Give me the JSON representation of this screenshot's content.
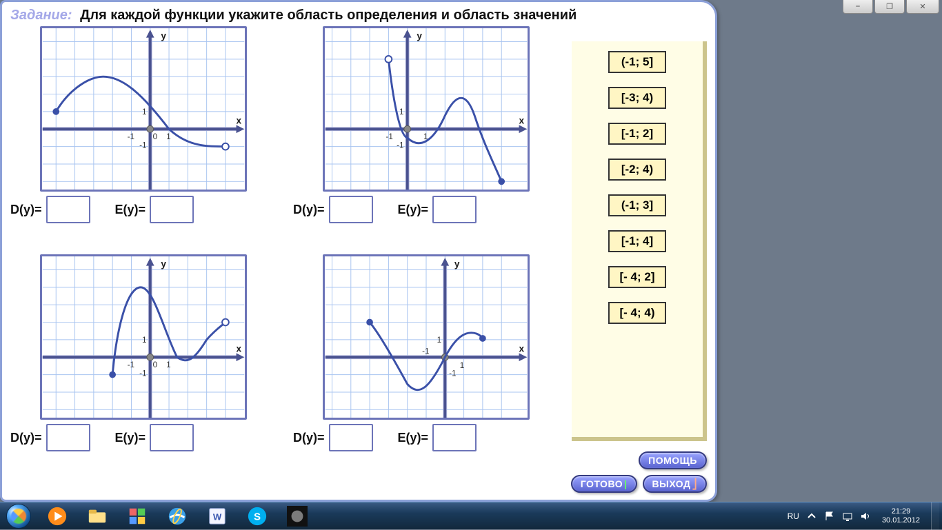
{
  "title": {
    "task_label": "Задание:",
    "text": "Для каждой функции укажите область определения и область значений"
  },
  "labels": {
    "D": "D(y)=",
    "E": "E(y)=",
    "x": "x",
    "y": "y"
  },
  "options": [
    "(-1; 5]",
    "[-3; 4)",
    "[-1; 2]",
    "[-2; 4)",
    "(-1; 3]",
    "[-1; 4]",
    "[- 4; 2]",
    "[- 4; 4)"
  ],
  "buttons": {
    "help": "ПОМОЩЬ",
    "done": "ГОТОВО",
    "exit": "ВЫХОД"
  },
  "window_controls": {
    "min": "⎯",
    "max": "❐",
    "close": "✕"
  },
  "taskbar": {
    "lang": "RU",
    "time": "21:29",
    "date": "30.01.2012"
  },
  "chart_data": [
    {
      "type": "line",
      "xlabel": "x",
      "ylabel": "y",
      "xlim": [
        -5,
        5
      ],
      "ylim": [
        -4,
        5
      ],
      "ticks_x": [
        -1,
        1
      ],
      "ticks_y": [
        -1,
        1
      ],
      "endpoints": [
        {
          "x": -5,
          "y": 1,
          "open": false
        },
        {
          "x": 4,
          "y": -1,
          "open": true
        }
      ],
      "points": [
        [
          -5,
          1
        ],
        [
          -4,
          2.2
        ],
        [
          -3,
          3
        ],
        [
          -2,
          3
        ],
        [
          -1,
          2.4
        ],
        [
          0,
          1.4
        ],
        [
          1,
          0
        ],
        [
          2,
          -0.7
        ],
        [
          3,
          -0.9
        ],
        [
          4,
          -1
        ]
      ],
      "domain_answer": "[-5; 4)",
      "range_answer": "(-1; 3]"
    },
    {
      "type": "line",
      "xlabel": "x",
      "ylabel": "y",
      "xlim": [
        -4,
        6
      ],
      "ylim": [
        -5,
        5
      ],
      "ticks_x": [
        -1,
        1
      ],
      "ticks_y": [
        -1,
        1
      ],
      "endpoints": [
        {
          "x": -1,
          "y": 4,
          "open": true
        },
        {
          "x": 5,
          "y": -3,
          "open": false
        }
      ],
      "points": [
        [
          -1,
          4
        ],
        [
          -0.5,
          1
        ],
        [
          0,
          -0.5
        ],
        [
          0.5,
          -1
        ],
        [
          1.5,
          -0.5
        ],
        [
          2.5,
          1
        ],
        [
          3,
          2
        ],
        [
          3.5,
          1.8
        ],
        [
          4,
          0.6
        ],
        [
          4.5,
          -1
        ],
        [
          5,
          -3
        ]
      ],
      "domain_answer": "(-1; 5]",
      "range_answer": "[-3; 4)"
    },
    {
      "type": "line",
      "xlabel": "x",
      "ylabel": "y",
      "xlim": [
        -5,
        5
      ],
      "ylim": [
        -4,
        5
      ],
      "ticks_x": [
        -1,
        1
      ],
      "ticks_y": [
        -1,
        1
      ],
      "endpoints": [
        {
          "x": -2,
          "y": -1,
          "open": false
        },
        {
          "x": 4,
          "y": 2,
          "open": true
        }
      ],
      "points": [
        [
          -2,
          -1
        ],
        [
          -1.5,
          1.5
        ],
        [
          -1,
          3.5
        ],
        [
          -0.5,
          4
        ],
        [
          0,
          3.4
        ],
        [
          0.5,
          2
        ],
        [
          1,
          0.6
        ],
        [
          1.5,
          0
        ],
        [
          2,
          0
        ],
        [
          2.5,
          0.3
        ],
        [
          3,
          1
        ],
        [
          3.5,
          1.6
        ],
        [
          4,
          2
        ]
      ],
      "domain_answer": "[-2; 4)",
      "range_answer": "[-1; 4]"
    },
    {
      "type": "line",
      "xlabel": "x",
      "ylabel": "y",
      "xlim": [
        -6,
        5
      ],
      "ylim": [
        -4,
        5
      ],
      "ticks_x": [
        -1,
        1
      ],
      "ticks_y": [
        -1,
        1
      ],
      "endpoints": [
        {
          "x": -4,
          "y": 2,
          "open": false
        },
        {
          "x": 2,
          "y": 1.2,
          "open": false
        }
      ],
      "points": [
        [
          -4,
          2
        ],
        [
          -3.3,
          1.3
        ],
        [
          -2.6,
          0.2
        ],
        [
          -2,
          -1
        ],
        [
          -1.3,
          -2
        ],
        [
          -0.7,
          -1.6
        ],
        [
          0,
          0
        ],
        [
          0.5,
          1
        ],
        [
          1,
          1.5
        ],
        [
          1.5,
          1.5
        ],
        [
          2,
          1.2
        ]
      ],
      "domain_answer": "[- 4; 2]",
      "range_answer": "[-2; 2]"
    }
  ]
}
